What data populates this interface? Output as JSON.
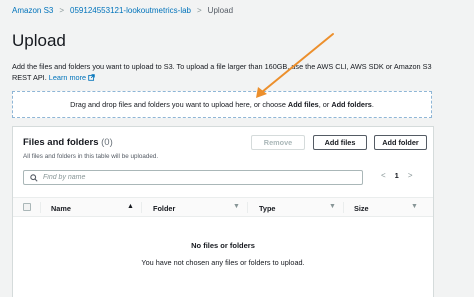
{
  "breadcrumb": {
    "items": [
      "Amazon S3",
      "059124553121-lookoutmetrics-lab",
      "Upload"
    ],
    "separator": ">"
  },
  "page": {
    "title": "Upload",
    "description": "Add the files and folders you want to upload to S3. To upload a file larger than 160GB, use the AWS CLI, AWS SDK or Amazon S3 REST API.",
    "learn_more": "Learn more"
  },
  "dropzone": {
    "text_before": "Drag and drop files and folders you want to upload here, or choose ",
    "add_files": "Add files",
    "text_middle": ", or ",
    "add_folders": "Add folders",
    "text_after": "."
  },
  "panel": {
    "title": "Files and folders",
    "count": "(0)",
    "subtitle": "All files and folders in this table will be uploaded.",
    "buttons": {
      "remove": "Remove",
      "add_files": "Add files",
      "add_folder": "Add folder"
    },
    "search": {
      "placeholder": "Find by name"
    },
    "pagination": {
      "prev": "<",
      "page": "1",
      "next": ">"
    },
    "columns": [
      "Name",
      "Folder",
      "Type",
      "Size"
    ],
    "empty_title": "No files or folders",
    "empty_subtitle": "You have not chosen any files or folders to upload."
  },
  "colors": {
    "link": "#0073bb",
    "annotation_arrow": "#ec8f2c",
    "background": "#f2f3f3"
  }
}
